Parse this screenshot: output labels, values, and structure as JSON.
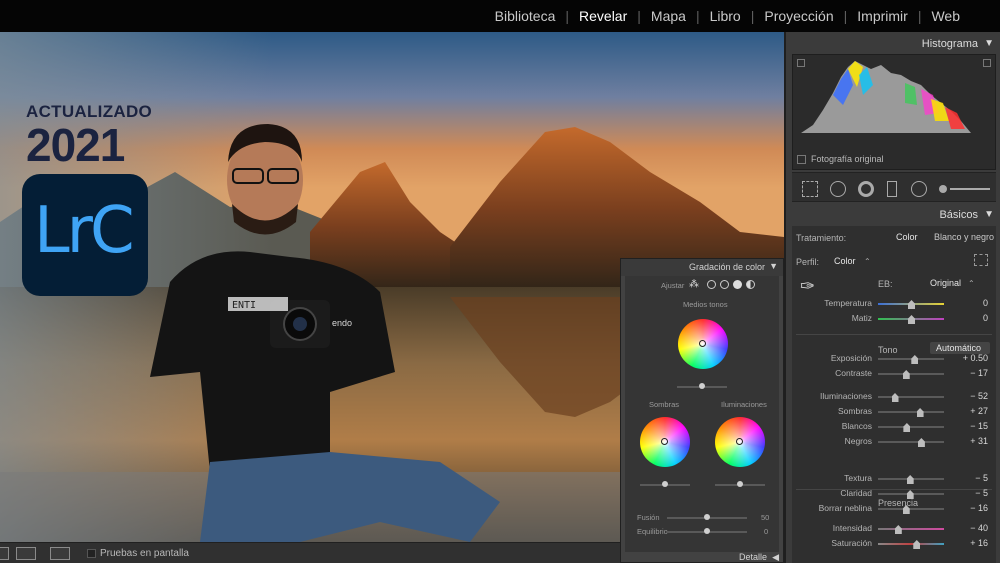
{
  "modules": [
    "Biblioteca",
    "Revelar",
    "Mapa",
    "Libro",
    "Proyección",
    "Imprimir",
    "Web"
  ],
  "badge": {
    "caption": "ACTUALIZADO",
    "year": "2021",
    "logo_text": "LrC"
  },
  "shirt_text": "ENTI",
  "shirt_text_2": "endo",
  "bottombar": {
    "proof_label": "Pruebas en pantalla"
  },
  "color_grading": {
    "title": "Gradación de color",
    "adjust_label": "Ajustar",
    "midtones_label": "Medios tonos",
    "shadows_label": "Sombras",
    "highlights_label": "Iluminaciones",
    "blending_label": "Fusión",
    "blending_value": "50",
    "balance_label": "Equilibrio",
    "balance_value": "0",
    "footer_label": "Detalle"
  },
  "histogram": {
    "title": "Histograma",
    "original_label": "Fotografía original"
  },
  "basic": {
    "title": "Básicos",
    "treatment_label": "Tratamiento:",
    "treatment_color": "Color",
    "treatment_bw": "Blanco y negro",
    "profile_label": "Perfil:",
    "profile_value": "Color",
    "wb_label": "EB:",
    "wb_value": "Original",
    "tone_label": "Tono",
    "auto_label": "Automático",
    "presence_label": "Presencia",
    "rows": [
      {
        "label": "Temperatura",
        "value": "0",
        "pos": 0.5
      },
      {
        "label": "Matiz",
        "value": "0",
        "pos": 0.5
      },
      {
        "label": "Exposición",
        "value": "+ 0.50",
        "pos": 0.55
      },
      {
        "label": "Contraste",
        "value": "− 17",
        "pos": 0.42
      },
      {
        "label": "Iluminaciones",
        "value": "− 52",
        "pos": 0.25
      },
      {
        "label": "Sombras",
        "value": "+ 27",
        "pos": 0.63
      },
      {
        "label": "Blancos",
        "value": "− 15",
        "pos": 0.43
      },
      {
        "label": "Negros",
        "value": "+ 31",
        "pos": 0.65
      },
      {
        "label": "Textura",
        "value": "− 5",
        "pos": 0.48
      },
      {
        "label": "Claridad",
        "value": "− 5",
        "pos": 0.48
      },
      {
        "label": "Borrar neblina",
        "value": "− 16",
        "pos": 0.42
      },
      {
        "label": "Intensidad",
        "value": "− 40",
        "pos": 0.3
      },
      {
        "label": "Saturación",
        "value": "+ 16",
        "pos": 0.58
      }
    ]
  },
  "colors": {
    "accent": "#3fa4f5",
    "logo_bg": "#041e36",
    "panel": "#3b3b3b"
  }
}
